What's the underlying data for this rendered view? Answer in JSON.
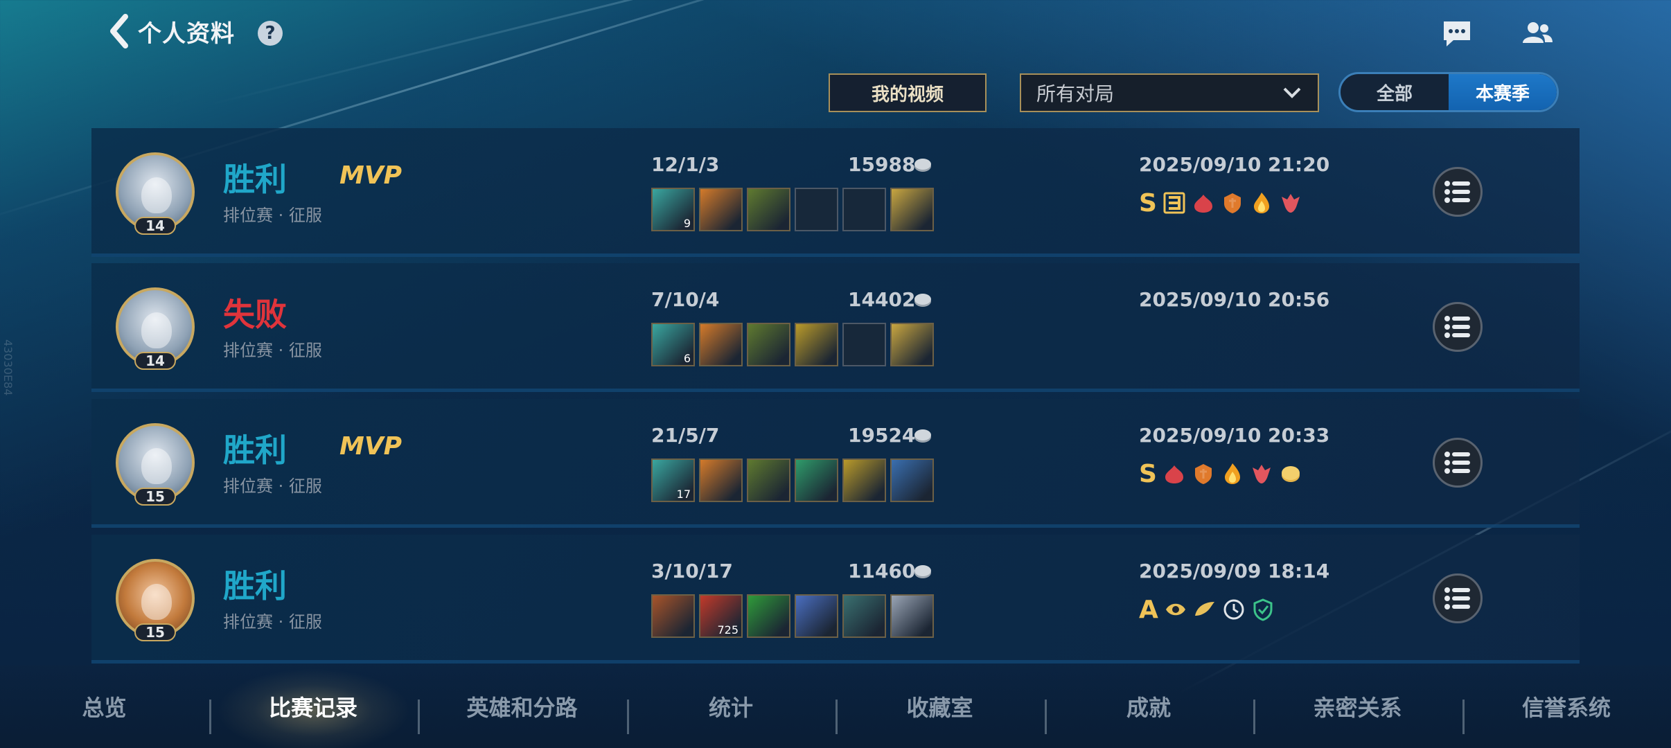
{
  "header": {
    "title": "个人资料",
    "help_glyph": "?"
  },
  "controls": {
    "video_button": "我的视频",
    "match_filter": "所有对局",
    "toggle_all": "全部",
    "toggle_season": "本赛季",
    "toggle_selected": "本赛季"
  },
  "matches": [
    {
      "result": "胜利",
      "result_type": "win",
      "mvp": "MVP",
      "mode": "排位赛 · 征服",
      "level": "14",
      "kda": "12/1/3",
      "gold": "15988",
      "items": [
        {
          "color": "#3aa7a0",
          "count": "9"
        },
        {
          "color": "#d47a2a",
          "count": ""
        },
        {
          "color": "#5f7a2f",
          "count": ""
        },
        {
          "empty": true
        },
        {
          "empty": true
        },
        {
          "color": "#c9a640",
          "count": ""
        }
      ],
      "time": "2025/09/10 21:20",
      "grade": "S",
      "badges": [
        "three-kill-badge",
        "flame-badge",
        "shield-badge",
        "fire-badge",
        "dragon-badge"
      ]
    },
    {
      "result": "失败",
      "result_type": "lose",
      "mvp": "",
      "mode": "排位赛 · 征服",
      "level": "14",
      "kda": "7/10/4",
      "gold": "14402",
      "items": [
        {
          "color": "#3aa7a0",
          "count": "6"
        },
        {
          "color": "#d47a2a",
          "count": ""
        },
        {
          "color": "#5f7a2f",
          "count": ""
        },
        {
          "color": "#b99a2a",
          "count": ""
        },
        {
          "empty": true
        },
        {
          "color": "#c9a640",
          "count": ""
        }
      ],
      "time": "2025/09/10 20:56",
      "grade": "",
      "badges": []
    },
    {
      "result": "胜利",
      "result_type": "win",
      "mvp": "MVP",
      "mode": "排位赛 · 征服",
      "level": "15",
      "kda": "21/5/7",
      "gold": "19524",
      "items": [
        {
          "color": "#3aa7a0",
          "count": "17"
        },
        {
          "color": "#d47a2a",
          "count": ""
        },
        {
          "color": "#5f7a2f",
          "count": ""
        },
        {
          "color": "#2f9b6a",
          "count": ""
        },
        {
          "color": "#b99a2a",
          "count": ""
        },
        {
          "color": "#3a6fb0",
          "count": ""
        }
      ],
      "time": "2025/09/10 20:33",
      "grade": "S",
      "badges": [
        "flame-badge",
        "shield-badge",
        "fire-badge",
        "dragon-badge",
        "coin-badge"
      ]
    },
    {
      "result": "胜利",
      "result_type": "win",
      "mvp": "",
      "mode": "排位赛 · 征服",
      "level": "15",
      "kda": "3/10/17",
      "gold": "11460",
      "items": [
        {
          "color": "#a8542a",
          "count": ""
        },
        {
          "color": "#c23a2a",
          "count": "725"
        },
        {
          "color": "#2f9a3a",
          "count": ""
        },
        {
          "color": "#4a6ec0",
          "count": ""
        },
        {
          "color": "#3a7070",
          "count": ""
        },
        {
          "color": "#9aa5b5",
          "count": ""
        }
      ],
      "time": "2025/09/09 18:14",
      "grade": "A",
      "badges": [
        "eye-badge",
        "wing-badge",
        "clock-badge",
        "guard-badge"
      ]
    }
  ],
  "nav": {
    "items": [
      "总览",
      "比赛记录",
      "英雄和分路",
      "统计",
      "收藏室",
      "成就",
      "亲密关系",
      "信誉系统"
    ],
    "active": "比赛记录"
  },
  "watermark": "43030E84"
}
